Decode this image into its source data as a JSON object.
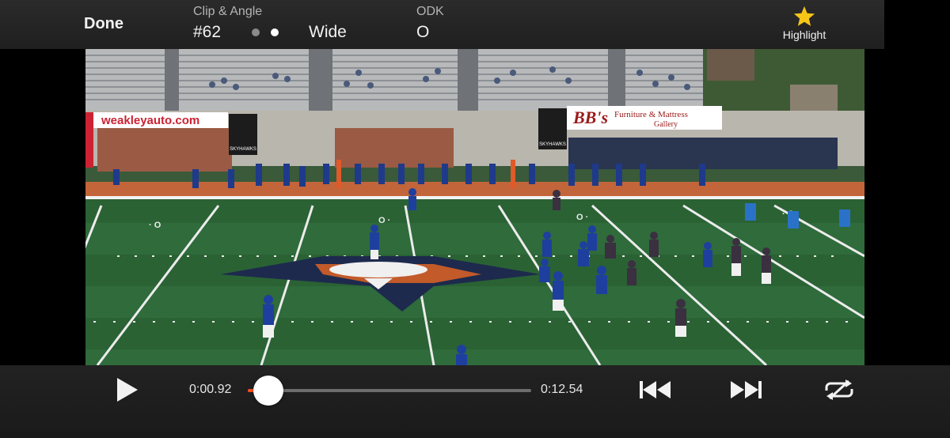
{
  "header": {
    "done_label": "Done",
    "clip_angle_label": "Clip & Angle",
    "clip_number": "#62",
    "angle_value": "Wide",
    "odk_label": "ODK",
    "odk_value": "O",
    "highlight_label": "Highlight"
  },
  "colors": {
    "highlight_star": "#f5c518",
    "progress_fill": "#ff4a1a",
    "progress_track": "#6d6d6d"
  },
  "video": {
    "banner_left": "weakleyauto.com",
    "banner_right_title": "BB's",
    "banner_right_sub": "Furniture & Mattress",
    "banner_right_sub2": "Gallery",
    "sign_left": "SKYHAWKS",
    "sign_right": "SKYHAWKS"
  },
  "playback": {
    "current_time": "0:00.92",
    "total_time": "0:12.54",
    "progress": 0.073
  },
  "icons": {
    "play": "play-icon",
    "skip_back": "skip-back-icon",
    "skip_forward": "skip-forward-icon",
    "loop": "loop-icon",
    "highlight": "star-icon"
  }
}
